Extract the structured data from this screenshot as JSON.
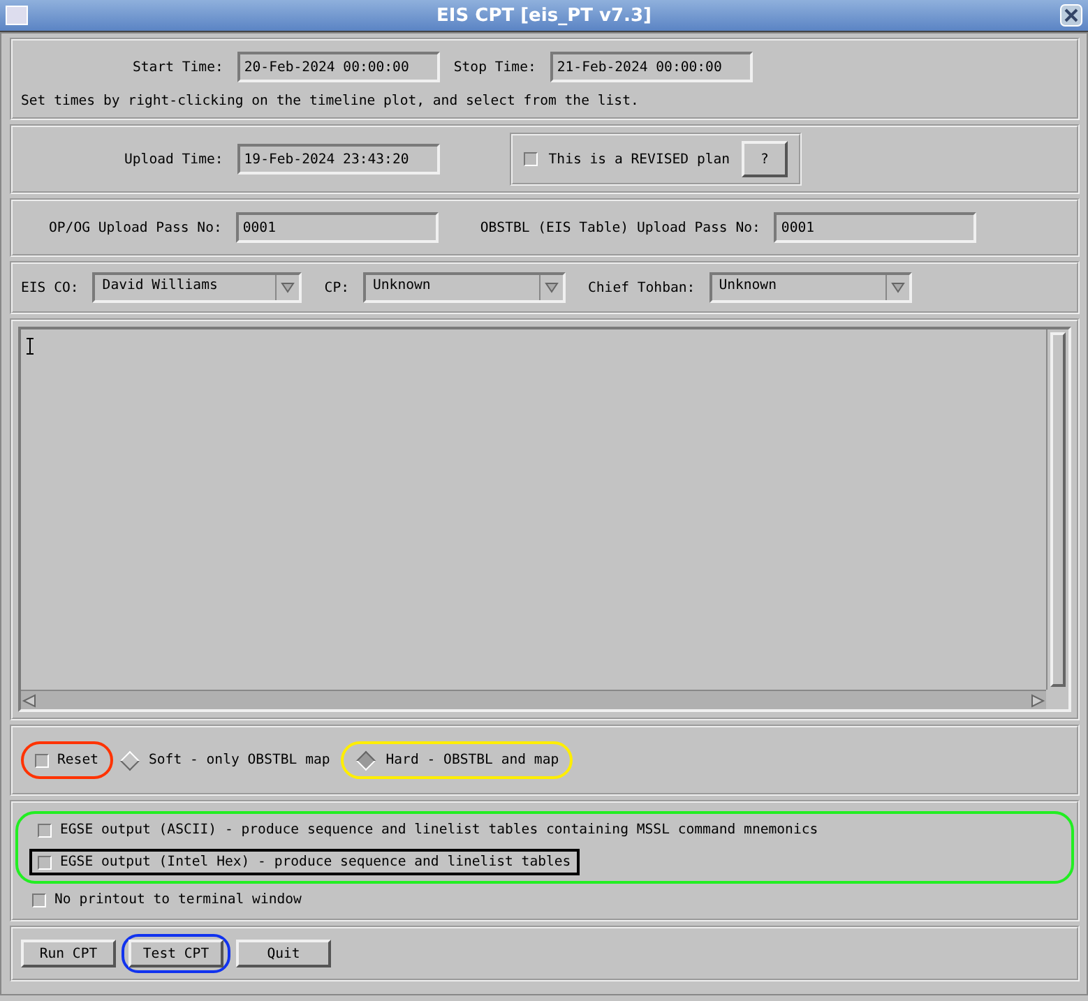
{
  "window": {
    "title": "EIS CPT [eis_PT v7.3]"
  },
  "times": {
    "start_label": "Start Time:",
    "start_value": "20-Feb-2024 00:00:00",
    "stop_label": "Stop Time:",
    "stop_value": "21-Feb-2024 00:00:00",
    "note": "Set times by right-clicking on the timeline plot, and select from the list."
  },
  "upload": {
    "label": "Upload Time:",
    "value": "19-Feb-2024 23:43:20",
    "revised": {
      "label": "This is a REVISED plan",
      "checked": false
    },
    "help_button": "?"
  },
  "pass_numbers": [
    {
      "label": "OP/OG Upload Pass No:",
      "value": "0001"
    },
    {
      "label": "OBSTBL (EIS Table) Upload Pass No:",
      "value": "0001"
    }
  ],
  "people": [
    {
      "label": "EIS CO:",
      "value": "David Williams"
    },
    {
      "label": "CP:",
      "value": "Unknown"
    },
    {
      "label": "Chief Tohban:",
      "value": "Unknown"
    }
  ],
  "reset": {
    "label": "Reset",
    "checked": false,
    "color": "#ff3300"
  },
  "reset_modes": [
    {
      "label": "Soft - only OBSTBL map",
      "selected": false
    },
    {
      "label": "Hard - OBSTBL and map",
      "selected": true,
      "color": "#ffee00"
    }
  ],
  "output_group": {
    "color": "#22ee22",
    "options": [
      {
        "label": "EGSE output (ASCII) - produce sequence and linelist tables containing MSSL command mnemonics",
        "checked": false
      },
      {
        "label": "EGSE output (Intel Hex) - produce sequence and linelist tables",
        "checked": false,
        "color": "#000000"
      }
    ]
  },
  "options": [
    {
      "label": "No printout to terminal window",
      "checked": false
    }
  ],
  "buttons": [
    {
      "label": "Run CPT"
    },
    {
      "label": "Test CPT",
      "color": "#1133ee"
    },
    {
      "label": "Quit"
    }
  ]
}
